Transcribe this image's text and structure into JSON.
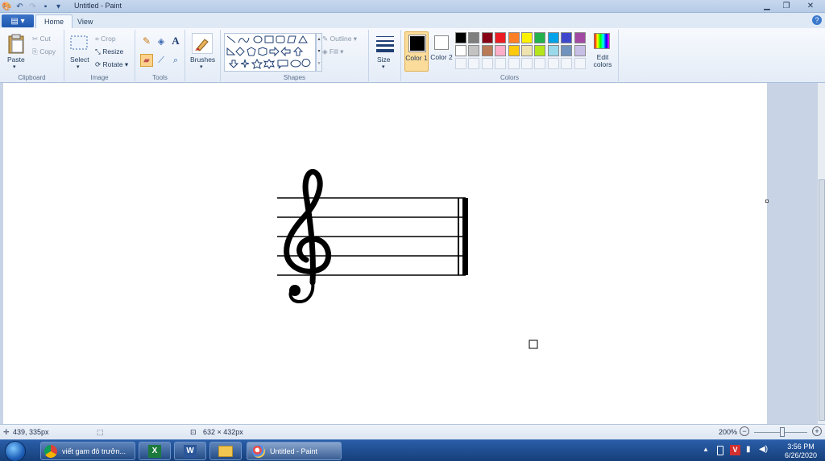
{
  "window": {
    "title": "Untitled - Paint",
    "controls": [
      "minimize",
      "maximize",
      "close"
    ]
  },
  "tabs": [
    {
      "label": "Home",
      "active": true
    },
    {
      "label": "View",
      "active": false
    }
  ],
  "ribbon": {
    "clipboard": {
      "group_label": "Clipboard",
      "paste": "Paste",
      "cut": "Cut",
      "copy": "Copy"
    },
    "image": {
      "group_label": "Image",
      "select": "Select",
      "crop": "Crop",
      "resize": "Resize",
      "rotate": "Rotate"
    },
    "tools": {
      "group_label": "Tools"
    },
    "brushes": {
      "label": "Brushes"
    },
    "shapes": {
      "group_label": "Shapes",
      "outline": "Outline",
      "fill": "Fill"
    },
    "size": {
      "label": "Size"
    },
    "colors": {
      "group_label": "Colors",
      "color1_label": "Color 1",
      "color2_label": "Color 2",
      "color1_value": "#000000",
      "color2_value": "#ffffff",
      "edit_label": "Edit colors",
      "palette_row1": [
        "#000000",
        "#7f7f7f",
        "#880015",
        "#ed1c24",
        "#ff7f27",
        "#fff200",
        "#22b14c",
        "#00a2e8",
        "#3f48cc",
        "#a349a4"
      ],
      "palette_row2": [
        "#ffffff",
        "#c3c3c3",
        "#b97a57",
        "#ffaec9",
        "#ffc90e",
        "#efe4b0",
        "#b5e61d",
        "#99d9ea",
        "#7092be",
        "#c8bfe7"
      ],
      "palette_row3": [
        "",
        "",
        "",
        "",
        "",
        "",
        "",
        "",
        "",
        ""
      ]
    }
  },
  "statusbar": {
    "cursor_position": "439, 335px",
    "canvas_size": "632 × 432px",
    "zoom": "200%"
  },
  "taskbar": {
    "items": [
      {
        "label": "viết gam đô trưởn...",
        "icon": "chrome-icon"
      },
      {
        "label": "",
        "icon": "excel-icon"
      },
      {
        "label": "",
        "icon": "word-icon"
      },
      {
        "label": "",
        "icon": "folder-icon"
      },
      {
        "label": "Untitled - Paint",
        "icon": "paint-icon"
      }
    ],
    "clock_time": "3:56 PM",
    "clock_date": "6/26/2020"
  }
}
